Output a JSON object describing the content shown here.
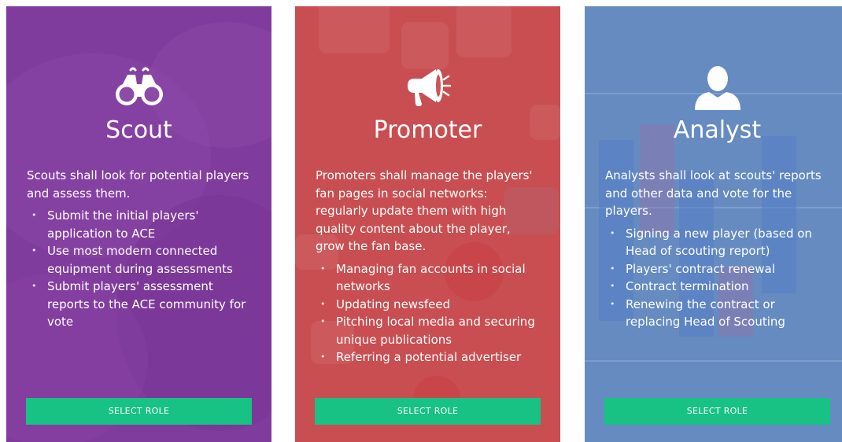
{
  "colors": {
    "scout_bg": "#8a4aa6",
    "promoter_bg": "#c9555a",
    "analyst_bg": "#6e93c4",
    "button_bg": "#17c284",
    "text": "#ffffff"
  },
  "cards": [
    {
      "icon": "binoculars-icon",
      "title": "Scout",
      "description": "Scouts shall look for potential players and assess them.",
      "bullets": [
        "Submit the initial players' application to ACE",
        "Use most modern connected equipment during assessments",
        "Submit players' assessment reports to the ACE community for vote"
      ],
      "button_label": "SELECT ROLE"
    },
    {
      "icon": "megaphone-icon",
      "title": "Promoter",
      "description": "Promoters shall manage the players' fan pages in social networks: regularly update them with high quality content about the player, grow the fan base.",
      "bullets": [
        "Managing fan accounts in social networks",
        "Updating newsfeed",
        "Pitching local media and securing unique publications",
        "Referring a potential advertiser"
      ],
      "button_label": "SELECT ROLE"
    },
    {
      "icon": "user-icon",
      "title": "Analyst",
      "description": "Analysts shall look at scouts' reports and other data and vote for the players.",
      "bullets": [
        "Signing a new player (based on Head of scouting report)",
        "Players' contract renewal",
        "Contract termination",
        "Renewing the contract or replacing Head of Scouting"
      ],
      "button_label": "SELECT ROLE"
    }
  ]
}
